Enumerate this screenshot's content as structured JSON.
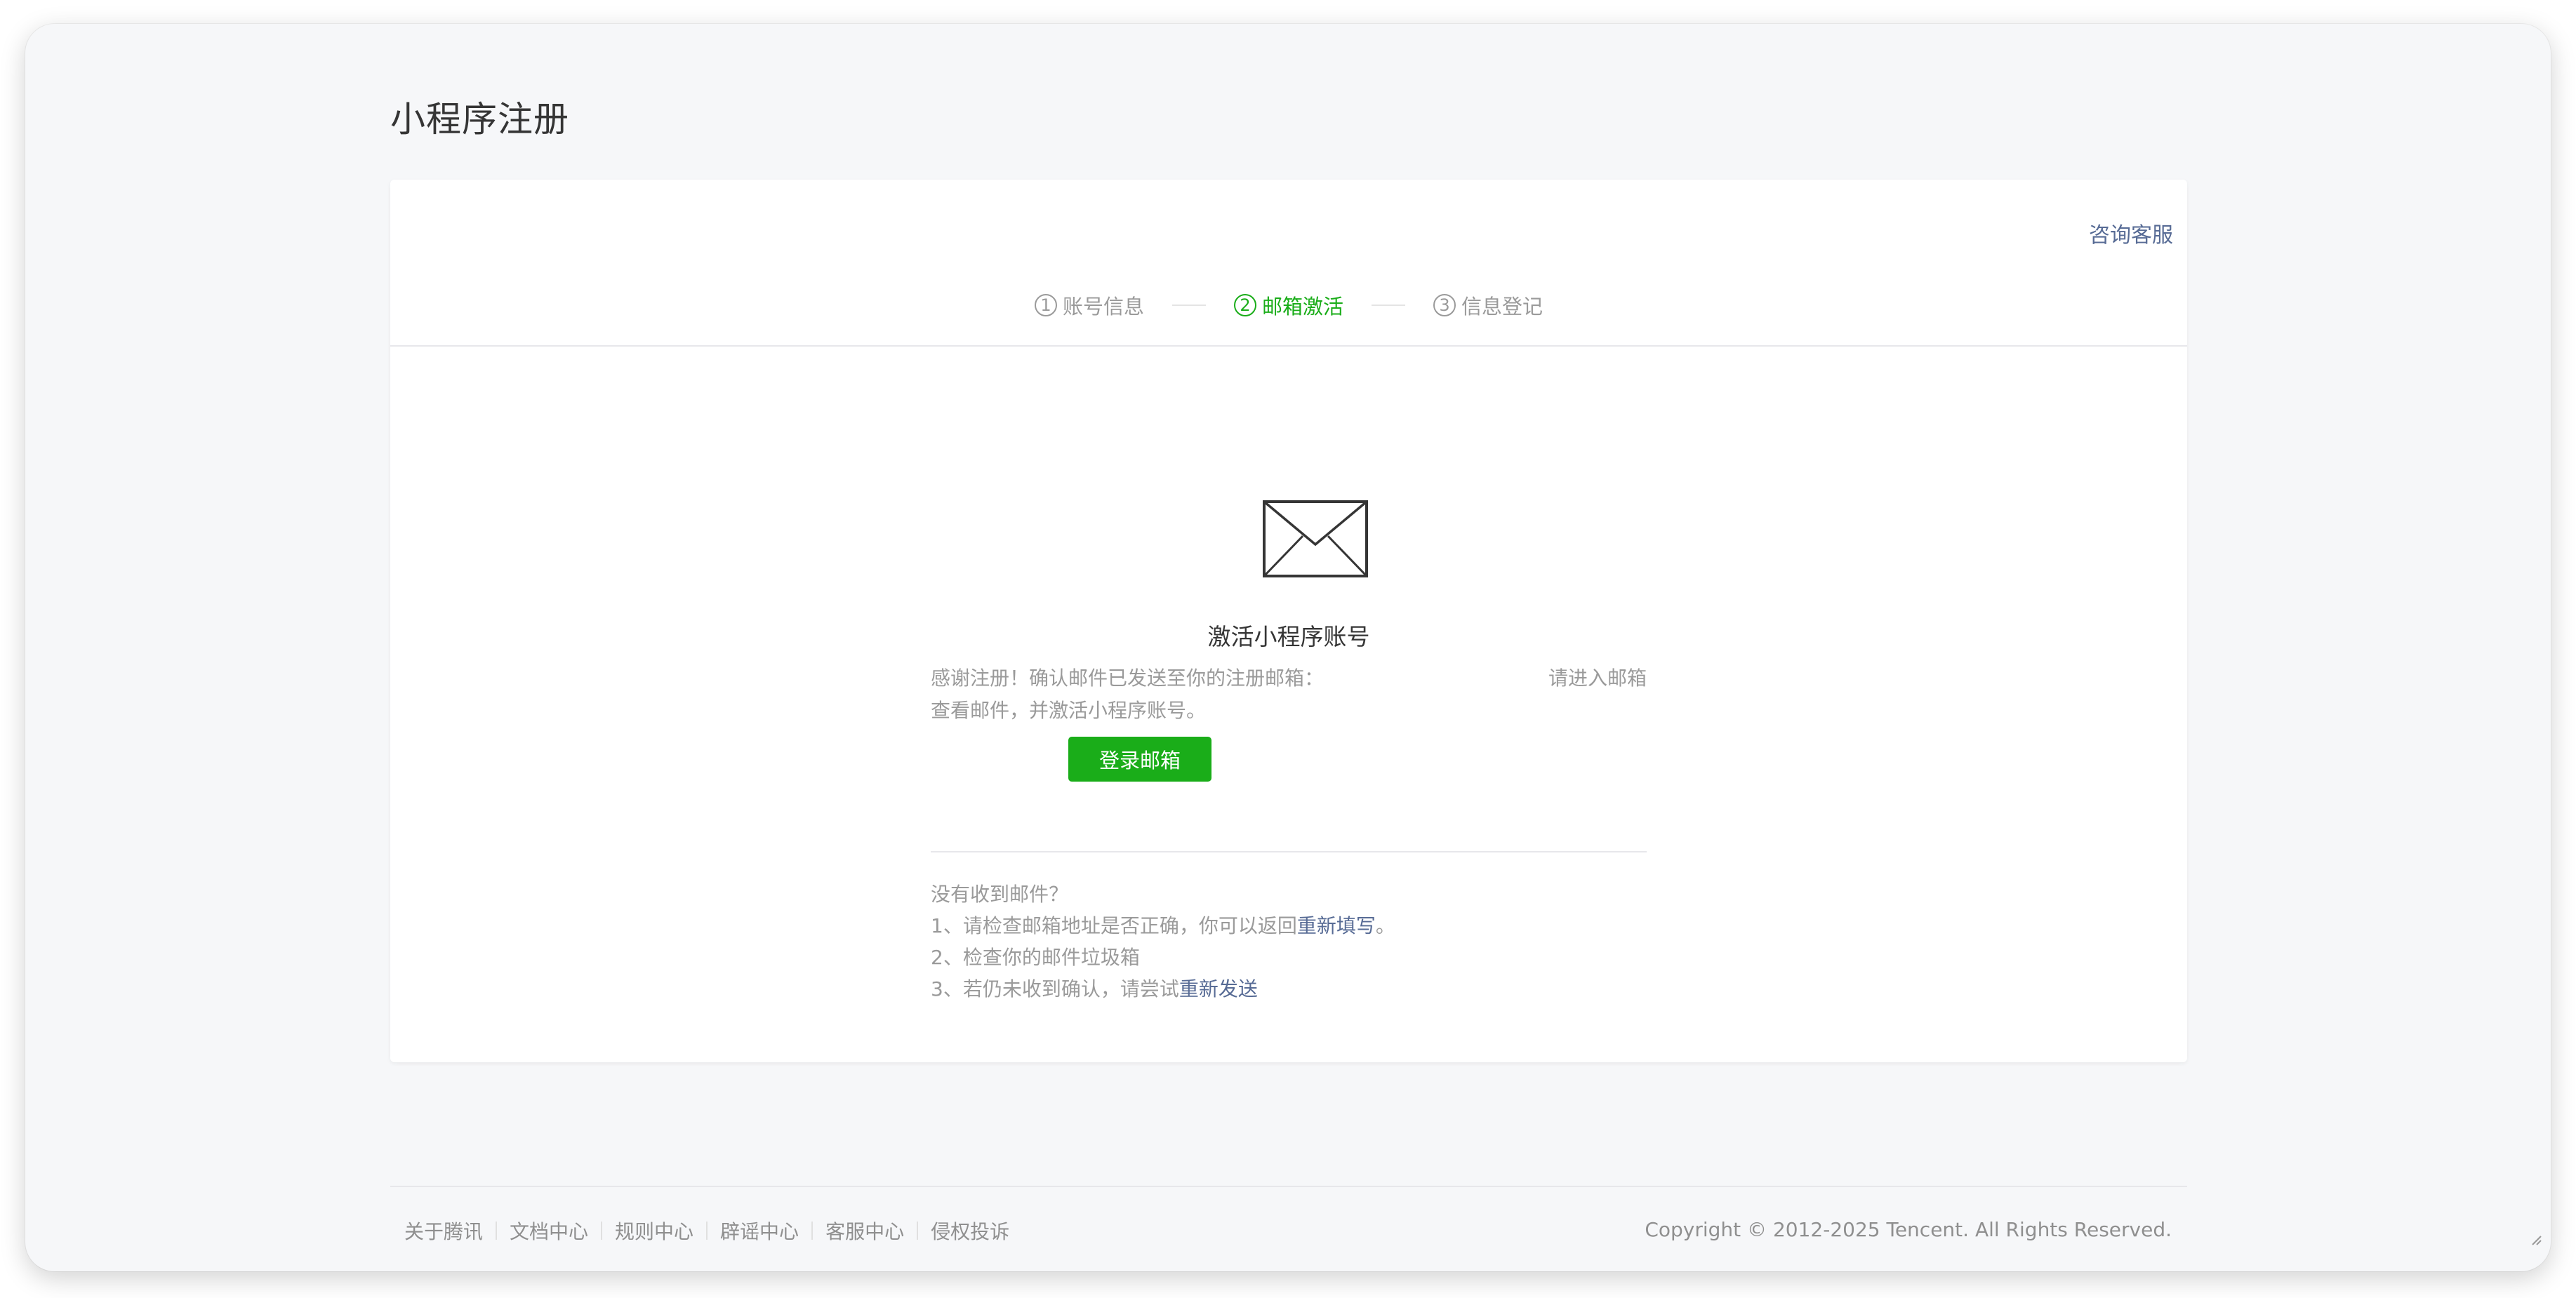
{
  "page": {
    "title": "小程序注册"
  },
  "header": {
    "consult_link": "咨询客服"
  },
  "steps": [
    {
      "num": "1",
      "label": "账号信息",
      "active": false
    },
    {
      "num": "2",
      "label": "邮箱激活",
      "active": true
    },
    {
      "num": "3",
      "label": "信息登记",
      "active": false
    }
  ],
  "main": {
    "icon": "envelope-icon",
    "title": "激活小程序账号",
    "desc_line1_left": "感谢注册！确认邮件已发送至你的注册邮箱：",
    "desc_line1_right": "请进入邮箱",
    "desc_line2": "查看邮件，并激活小程序账号。",
    "login_button": "登录邮箱"
  },
  "help": {
    "heading": "没有收到邮件？",
    "item1_prefix": "1、请检查邮箱地址是否正确，你可以返回",
    "item1_link": "重新填写",
    "item1_suffix": "。",
    "item2": "2、检查你的邮件垃圾箱",
    "item3_prefix": "3、若仍未收到确认，请尝试",
    "item3_link": "重新发送"
  },
  "footer": {
    "links": [
      "关于腾讯",
      "文档中心",
      "规则中心",
      "辟谣中心",
      "客服中心",
      "侵权投诉"
    ],
    "copyright": "Copyright © 2012-2025 Tencent. All Rights Reserved."
  },
  "colors": {
    "accent": "#1aad19",
    "link": "#576b95",
    "muted": "#9a9a9a"
  }
}
